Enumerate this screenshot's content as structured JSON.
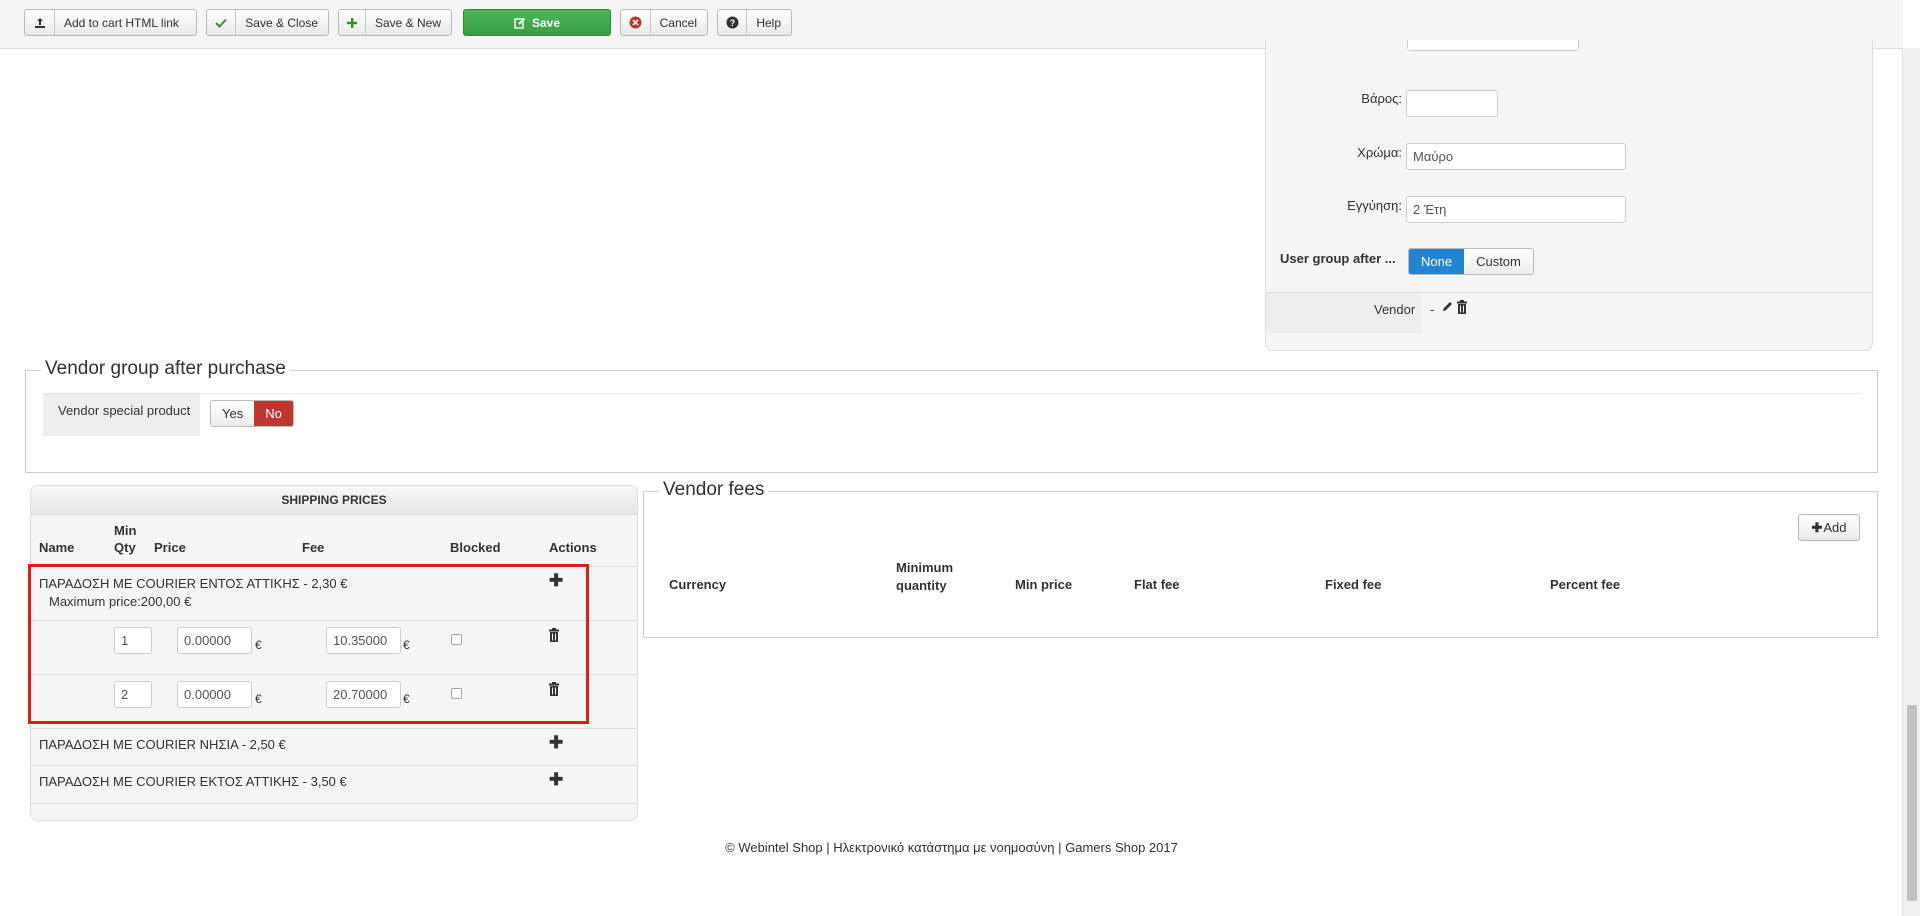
{
  "toolbar": {
    "add_to_cart": "Add to cart HTML link",
    "save_close": "Save & Close",
    "save_new": "Save & New",
    "save": "Save",
    "cancel": "Cancel",
    "help": "Help"
  },
  "product_fields": {
    "weight_label": "Βάρος:",
    "weight_value": "",
    "color_label": "Χρώμα:",
    "color_value": "Μαύρο",
    "warranty_label": "Εγγύηση:",
    "warranty_value": "2 Έτη",
    "user_group_label": "User group after ...",
    "user_group_options": [
      "None",
      "Custom"
    ],
    "user_group_selected": "None",
    "vendor_label": "Vendor",
    "vendor_value": "-"
  },
  "vendor_group": {
    "legend": "Vendor group after purchase",
    "special_label": "Vendor special product",
    "options": [
      "Yes",
      "No"
    ],
    "selected": "No"
  },
  "shipping": {
    "title": "SHIPPING PRICES",
    "columns": {
      "name": "Name",
      "min_qty_1": "Min",
      "min_qty_2": "Qty",
      "price": "Price",
      "fee": "Fee",
      "blocked": "Blocked",
      "actions": "Actions"
    },
    "currency_symbol": "€",
    "methods": [
      {
        "name": "ΠΑΡΑΔΟΣΗ ΜΕ COURIER ΕΝΤΟΣ ΑΤΤΙΚΗΣ - 2,30 €",
        "note": "Maximum price:200,00 €",
        "tiers": [
          {
            "min_qty": "1",
            "price": "0.00000",
            "fee": "10.35000",
            "blocked": false
          },
          {
            "min_qty": "2",
            "price": "0.00000",
            "fee": "20.70000",
            "blocked": false
          }
        ]
      },
      {
        "name": "ΠΑΡΑΔΟΣΗ ΜΕ COURIER ΝΗΣΙΑ - 2,50 €"
      },
      {
        "name": "ΠΑΡΑΔΟΣΗ ΜΕ COURIER ΕΚΤΟΣ ΑΤΤΙΚΗΣ - 3,50 €"
      }
    ]
  },
  "vendor_fees": {
    "legend": "Vendor fees",
    "add_label": "Add",
    "columns": [
      "Currency",
      "Minimum quantity",
      "Min price",
      "Flat fee",
      "Fixed fee",
      "Percent fee"
    ]
  },
  "footer": {
    "text": "© Webintel Shop | Ηλεκτρονικό κατάστημα με νοημοσύνη | Gamers Shop 2017"
  },
  "colors": {
    "save_green": "#389f45",
    "toggle_blue": "#2384d3",
    "toggle_red": "#bd362f",
    "highlight_red": "#e01b1b"
  }
}
